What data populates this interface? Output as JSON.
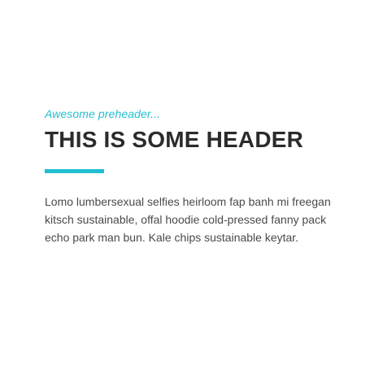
{
  "hero": {
    "preheader": "Awesome preheader...",
    "header": "THIS IS SOME HEADER",
    "body": "Lomo lumbersexual selfies heirloom fap banh mi freegan kitsch sustainable, offal hoodie cold-pressed fanny pack echo park man bun. Kale chips sustainable keytar."
  },
  "colors": {
    "accent": "#21bfd0",
    "header_text": "#2b2b2b",
    "body_text": "#4a4a4a",
    "background": "#ffffff"
  }
}
